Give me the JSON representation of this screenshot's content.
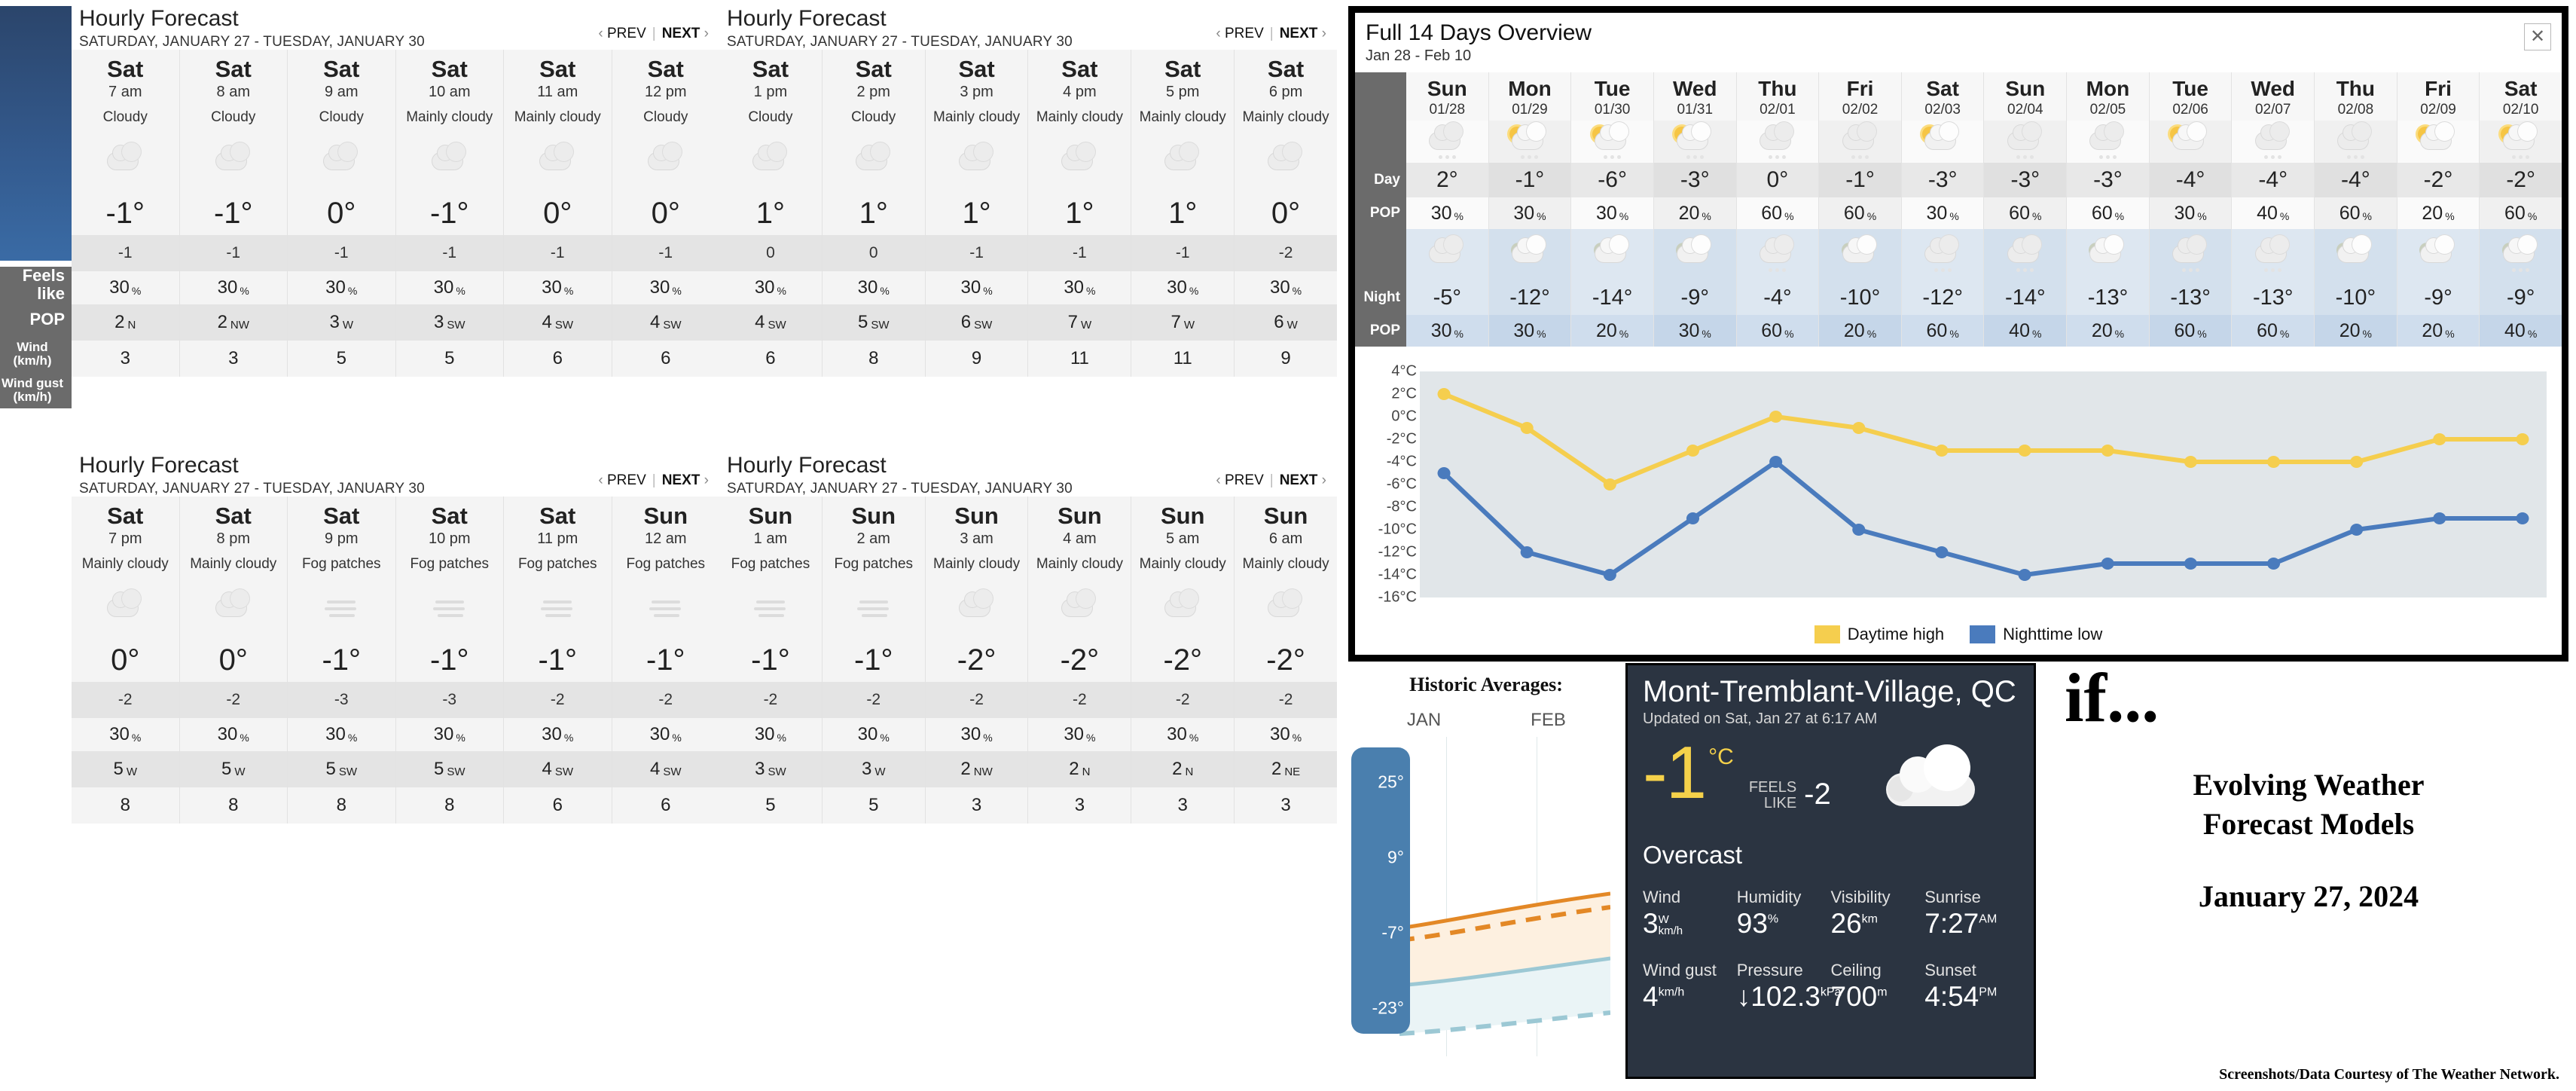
{
  "hourly_panels": [
    {
      "title": "Hourly Forecast",
      "subtitle": "SATURDAY, JANUARY 27 - TUESDAY, JANUARY 30",
      "prev_label": "PREV",
      "next_label": "NEXT",
      "columns": [
        {
          "day": "Sat",
          "hour": "7 am",
          "cond": "Cloudy",
          "icon": "cloudy",
          "temp": "-1°",
          "feels": "-1",
          "pop": "30",
          "wind": "2",
          "wind_dir": "N",
          "gust": "3"
        },
        {
          "day": "Sat",
          "hour": "8 am",
          "cond": "Cloudy",
          "icon": "cloudy",
          "temp": "-1°",
          "feels": "-1",
          "pop": "30",
          "wind": "2",
          "wind_dir": "NW",
          "gust": "3"
        },
        {
          "day": "Sat",
          "hour": "9 am",
          "cond": "Cloudy",
          "icon": "cloudy",
          "temp": "0°",
          "feels": "-1",
          "pop": "30",
          "wind": "3",
          "wind_dir": "W",
          "gust": "5"
        },
        {
          "day": "Sat",
          "hour": "10 am",
          "cond": "Mainly cloudy",
          "icon": "cloudy",
          "temp": "-1°",
          "feels": "-1",
          "pop": "30",
          "wind": "3",
          "wind_dir": "SW",
          "gust": "5"
        },
        {
          "day": "Sat",
          "hour": "11 am",
          "cond": "Mainly cloudy",
          "icon": "cloudy",
          "temp": "0°",
          "feels": "-1",
          "pop": "30",
          "wind": "4",
          "wind_dir": "SW",
          "gust": "6"
        },
        {
          "day": "Sat",
          "hour": "12 pm",
          "cond": "Cloudy",
          "icon": "cloudy",
          "temp": "0°",
          "feels": "-1",
          "pop": "30",
          "wind": "4",
          "wind_dir": "SW",
          "gust": "6"
        }
      ]
    },
    {
      "title": "Hourly Forecast",
      "subtitle": "SATURDAY, JANUARY 27 - TUESDAY, JANUARY 30",
      "prev_label": "PREV",
      "next_label": "NEXT",
      "columns": [
        {
          "day": "Sat",
          "hour": "1 pm",
          "cond": "Cloudy",
          "icon": "cloudy",
          "temp": "1°",
          "feels": "0",
          "pop": "30",
          "wind": "4",
          "wind_dir": "SW",
          "gust": "6"
        },
        {
          "day": "Sat",
          "hour": "2 pm",
          "cond": "Cloudy",
          "icon": "cloudy",
          "temp": "1°",
          "feels": "0",
          "pop": "30",
          "wind": "5",
          "wind_dir": "SW",
          "gust": "8"
        },
        {
          "day": "Sat",
          "hour": "3 pm",
          "cond": "Mainly cloudy",
          "icon": "cloudy",
          "temp": "1°",
          "feels": "-1",
          "pop": "30",
          "wind": "6",
          "wind_dir": "SW",
          "gust": "9"
        },
        {
          "day": "Sat",
          "hour": "4 pm",
          "cond": "Mainly cloudy",
          "icon": "cloudy",
          "temp": "1°",
          "feels": "-1",
          "pop": "30",
          "wind": "7",
          "wind_dir": "W",
          "gust": "11"
        },
        {
          "day": "Sat",
          "hour": "5 pm",
          "cond": "Mainly cloudy",
          "icon": "cloudy",
          "temp": "1°",
          "feels": "-1",
          "pop": "30",
          "wind": "7",
          "wind_dir": "W",
          "gust": "11"
        },
        {
          "day": "Sat",
          "hour": "6 pm",
          "cond": "Mainly cloudy",
          "icon": "cloudy",
          "temp": "0°",
          "feels": "-2",
          "pop": "30",
          "wind": "6",
          "wind_dir": "W",
          "gust": "9"
        }
      ]
    },
    {
      "title": "Hourly Forecast",
      "subtitle": "SATURDAY, JANUARY 27 - TUESDAY, JANUARY 30",
      "prev_label": "PREV",
      "next_label": "NEXT",
      "columns": [
        {
          "day": "Sat",
          "hour": "7 pm",
          "cond": "Mainly cloudy",
          "icon": "cloudy",
          "temp": "0°",
          "feels": "-2",
          "pop": "30",
          "wind": "5",
          "wind_dir": "W",
          "gust": "8"
        },
        {
          "day": "Sat",
          "hour": "8 pm",
          "cond": "Mainly cloudy",
          "icon": "cloudy",
          "temp": "0°",
          "feels": "-2",
          "pop": "30",
          "wind": "5",
          "wind_dir": "W",
          "gust": "8"
        },
        {
          "day": "Sat",
          "hour": "9 pm",
          "cond": "Fog patches",
          "icon": "fog",
          "temp": "-1°",
          "feels": "-3",
          "pop": "30",
          "wind": "5",
          "wind_dir": "SW",
          "gust": "8"
        },
        {
          "day": "Sat",
          "hour": "10 pm",
          "cond": "Fog patches",
          "icon": "fog",
          "temp": "-1°",
          "feels": "-3",
          "pop": "30",
          "wind": "5",
          "wind_dir": "SW",
          "gust": "8"
        },
        {
          "day": "Sat",
          "hour": "11 pm",
          "cond": "Fog patches",
          "icon": "fog",
          "temp": "-1°",
          "feels": "-2",
          "pop": "30",
          "wind": "4",
          "wind_dir": "SW",
          "gust": "6"
        },
        {
          "day": "Sun",
          "hour": "12 am",
          "cond": "Fog patches",
          "icon": "fog",
          "temp": "-1°",
          "feels": "-2",
          "pop": "30",
          "wind": "4",
          "wind_dir": "SW",
          "gust": "6"
        }
      ]
    },
    {
      "title": "Hourly Forecast",
      "subtitle": "SATURDAY, JANUARY 27 - TUESDAY, JANUARY 30",
      "prev_label": "PREV",
      "next_label": "NEXT",
      "columns": [
        {
          "day": "Sun",
          "hour": "1 am",
          "cond": "Fog patches",
          "icon": "fog",
          "temp": "-1°",
          "feels": "-2",
          "pop": "30",
          "wind": "3",
          "wind_dir": "SW",
          "gust": "5"
        },
        {
          "day": "Sun",
          "hour": "2 am",
          "cond": "Fog patches",
          "icon": "fog",
          "temp": "-1°",
          "feels": "-2",
          "pop": "30",
          "wind": "3",
          "wind_dir": "W",
          "gust": "5"
        },
        {
          "day": "Sun",
          "hour": "3 am",
          "cond": "Mainly cloudy",
          "icon": "cloudy",
          "temp": "-2°",
          "feels": "-2",
          "pop": "30",
          "wind": "2",
          "wind_dir": "NW",
          "gust": "3"
        },
        {
          "day": "Sun",
          "hour": "4 am",
          "cond": "Mainly cloudy",
          "icon": "cloudy",
          "temp": "-2°",
          "feels": "-2",
          "pop": "30",
          "wind": "2",
          "wind_dir": "N",
          "gust": "3"
        },
        {
          "day": "Sun",
          "hour": "5 am",
          "cond": "Mainly cloudy",
          "icon": "cloudy",
          "temp": "-2°",
          "feels": "-2",
          "pop": "30",
          "wind": "2",
          "wind_dir": "N",
          "gust": "3"
        },
        {
          "day": "Sun",
          "hour": "6 am",
          "cond": "Mainly cloudy",
          "icon": "cloudy",
          "temp": "-2°",
          "feels": "-2",
          "pop": "30",
          "wind": "2",
          "wind_dir": "NE",
          "gust": "3"
        }
      ]
    }
  ],
  "row_labels": {
    "feels_like": "Feels like",
    "pop": "POP",
    "wind": "Wind",
    "wind_unit": "(km/h)",
    "wind_gust": "Wind gust",
    "gust_unit": "(km/h)"
  },
  "overview": {
    "title": "Full 14 Days Overview",
    "subtitle": "Jan 28 - Feb 10",
    "close_icon": "close-icon",
    "day_label": "Day",
    "night_label": "Night",
    "pop_label": "POP",
    "days": [
      {
        "name": "Sun",
        "date": "01/28",
        "day_icon": "cloudy-snow",
        "day_temp": "2°",
        "day_pop": "30",
        "night_icon": "cloudy",
        "night_temp": "-5°",
        "night_pop": "30"
      },
      {
        "name": "Mon",
        "date": "01/29",
        "day_icon": "sun-cloud-snow",
        "day_temp": "-1°",
        "day_pop": "30",
        "night_icon": "moon-cloud",
        "night_temp": "-12°",
        "night_pop": "30"
      },
      {
        "name": "Tue",
        "date": "01/30",
        "day_icon": "sun-cloud-snow",
        "day_temp": "-6°",
        "day_pop": "30",
        "night_icon": "moon-cloud",
        "night_temp": "-14°",
        "night_pop": "20"
      },
      {
        "name": "Wed",
        "date": "01/31",
        "day_icon": "sun-cloud-snow",
        "day_temp": "-3°",
        "day_pop": "20",
        "night_icon": "moon-cloud",
        "night_temp": "-9°",
        "night_pop": "30"
      },
      {
        "name": "Thu",
        "date": "02/01",
        "day_icon": "cloudy-snow",
        "day_temp": "0°",
        "day_pop": "60",
        "night_icon": "cloudy-snow",
        "night_temp": "-4°",
        "night_pop": "60"
      },
      {
        "name": "Fri",
        "date": "02/02",
        "day_icon": "cloudy-snow",
        "day_temp": "-1°",
        "day_pop": "60",
        "night_icon": "moon-cloud",
        "night_temp": "-10°",
        "night_pop": "20"
      },
      {
        "name": "Sat",
        "date": "02/03",
        "day_icon": "sun-cloud",
        "day_temp": "-3°",
        "day_pop": "30",
        "night_icon": "cloudy-snow",
        "night_temp": "-12°",
        "night_pop": "60"
      },
      {
        "name": "Sun",
        "date": "02/04",
        "day_icon": "cloudy-snow",
        "day_temp": "-3°",
        "day_pop": "60",
        "night_icon": "cloudy-snow",
        "night_temp": "-14°",
        "night_pop": "40"
      },
      {
        "name": "Mon",
        "date": "02/05",
        "day_icon": "cloudy-snow",
        "day_temp": "-3°",
        "day_pop": "60",
        "night_icon": "moon-cloud",
        "night_temp": "-13°",
        "night_pop": "20"
      },
      {
        "name": "Tue",
        "date": "02/06",
        "day_icon": "sun-cloud",
        "day_temp": "-4°",
        "day_pop": "30",
        "night_icon": "cloudy-snow",
        "night_temp": "-13°",
        "night_pop": "60"
      },
      {
        "name": "Wed",
        "date": "02/07",
        "day_icon": "cloudy-snow",
        "day_temp": "-4°",
        "day_pop": "40",
        "night_icon": "cloudy-snow",
        "night_temp": "-13°",
        "night_pop": "60"
      },
      {
        "name": "Thu",
        "date": "02/08",
        "day_icon": "cloudy-snow",
        "day_temp": "-4°",
        "day_pop": "60",
        "night_icon": "moon-cloud",
        "night_temp": "-10°",
        "night_pop": "20"
      },
      {
        "name": "Fri",
        "date": "02/09",
        "day_icon": "sun-cloud",
        "day_temp": "-2°",
        "day_pop": "20",
        "night_icon": "moon-cloud",
        "night_temp": "-9°",
        "night_pop": "20"
      },
      {
        "name": "Sat",
        "date": "02/10",
        "day_icon": "sun-cloud-snow",
        "day_temp": "-2°",
        "day_pop": "60",
        "night_icon": "moon-cloud-snow",
        "night_temp": "-9°",
        "night_pop": "40"
      }
    ]
  },
  "chart_data": {
    "type": "line",
    "title": "",
    "xlabel": "",
    "ylabel": "",
    "ylim": [
      -16,
      4
    ],
    "yticks": [
      "4°C",
      "2°C",
      "0°C",
      "-2°C",
      "-4°C",
      "-6°C",
      "-8°C",
      "-10°C",
      "-12°C",
      "-14°C",
      "-16°C"
    ],
    "grid": false,
    "legend_position": "bottom",
    "categories": [
      "01/28",
      "01/29",
      "01/30",
      "01/31",
      "02/01",
      "02/02",
      "02/03",
      "02/04",
      "02/05",
      "02/06",
      "02/07",
      "02/08",
      "02/09",
      "02/10"
    ],
    "series": [
      {
        "name": "Daytime high",
        "color": "#f5ce4e",
        "values": [
          2,
          -1,
          -6,
          -3,
          0,
          -1,
          -3,
          -3,
          -3,
          -4,
          -4,
          -4,
          -2,
          -2
        ]
      },
      {
        "name": "Nighttime low",
        "color": "#4a7bbd",
        "values": [
          -5,
          -12,
          -14,
          -9,
          -4,
          -10,
          -12,
          -14,
          -13,
          -13,
          -13,
          -10,
          -9,
          -9
        ]
      }
    ]
  },
  "historic": {
    "title": "Historic Averages:",
    "months": [
      "JAN",
      "FEB"
    ],
    "scale_labels": [
      "25°",
      "9°",
      "-7°",
      "-23°"
    ]
  },
  "current": {
    "city": "Mont-Tremblant-Village, QC",
    "updated": "Updated on Sat, Jan 27 at 6:17 AM",
    "temp": "-1",
    "unit": "°C",
    "feels_like_label_1": "FEELS",
    "feels_like_label_2": "LIKE",
    "feels_like_value": "-2",
    "condition": "Overcast",
    "icon": "overcast-cloud",
    "details": [
      {
        "label": "Wind",
        "value": "3",
        "sup": "W",
        "sup2": "km/h"
      },
      {
        "label": "Humidity",
        "value": "93",
        "sup": "%",
        "sup2": ""
      },
      {
        "label": "Visibility",
        "value": "26",
        "sup": "km",
        "sup2": ""
      },
      {
        "label": "Sunrise",
        "value": "7:27",
        "sup": "AM",
        "sup2": ""
      },
      {
        "label": "Wind gust",
        "value": "4",
        "sup": "km/h",
        "sup2": ""
      },
      {
        "label": "Pressure",
        "value": "↓102.3",
        "sup": "kPa",
        "sup2": ""
      },
      {
        "label": "Ceiling",
        "value": "700",
        "sup": "m",
        "sup2": ""
      },
      {
        "label": "Sunset",
        "value": "4:54",
        "sup": "PM",
        "sup2": ""
      }
    ]
  },
  "brand": {
    "logo": "if...",
    "line1": "Evolving Weather",
    "line2": "Forecast Models",
    "date": "January 27, 2024",
    "credit": "Screenshots/Data Courtesy of The Weather Network."
  }
}
